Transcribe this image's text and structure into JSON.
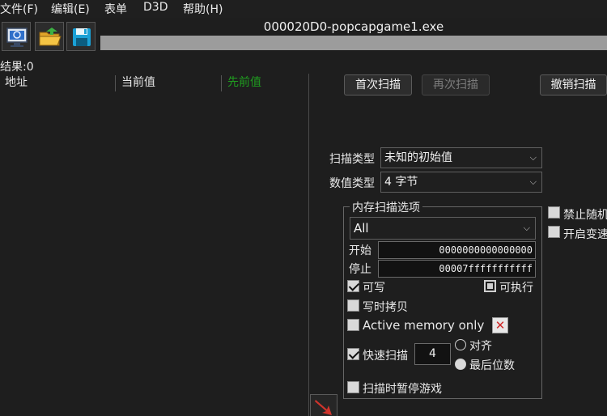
{
  "menu": {
    "file": "文件(F)",
    "edit": "编辑(E)",
    "table": "表单",
    "d3d": "D3D",
    "help": "帮助(H)"
  },
  "toolbar": {
    "open_process_icon": "computer-icon",
    "open_file_icon": "folder-open-icon",
    "save_icon": "save-icon"
  },
  "process_title": "000020D0-popcapgame1.exe",
  "results": {
    "count_label": "结果:0",
    "columns": [
      "地址",
      "当前值",
      "先前值"
    ]
  },
  "buttons": {
    "first_scan": "首次扫描",
    "next_scan": "再次扫描",
    "undo_scan": "撤销扫描"
  },
  "scan_type": {
    "label": "扫描类型",
    "value": "未知的初始值"
  },
  "value_type": {
    "label": "数值类型",
    "value": "4 字节"
  },
  "memory_options": {
    "title": "内存扫描选项",
    "region": "All",
    "start_label": "开始",
    "start_value": "0000000000000000",
    "stop_label": "停止",
    "stop_value": "00007fffffffffff",
    "writable": "可写",
    "executable": "可执行",
    "copy_on_write": "写时拷贝",
    "active_memory_only": "Active memory only",
    "fast_scan": "快速扫描",
    "fast_scan_value": "4",
    "alignment": "对齐",
    "last_digits": "最后位数",
    "pause_game": "扫描时暂停游戏"
  },
  "side_options": {
    "disable_random": "禁止随机",
    "enable_speedhack": "开启变速"
  },
  "colors": {
    "previous_value_header": "#1f9e1f",
    "accent_red": "#d12a2a"
  }
}
